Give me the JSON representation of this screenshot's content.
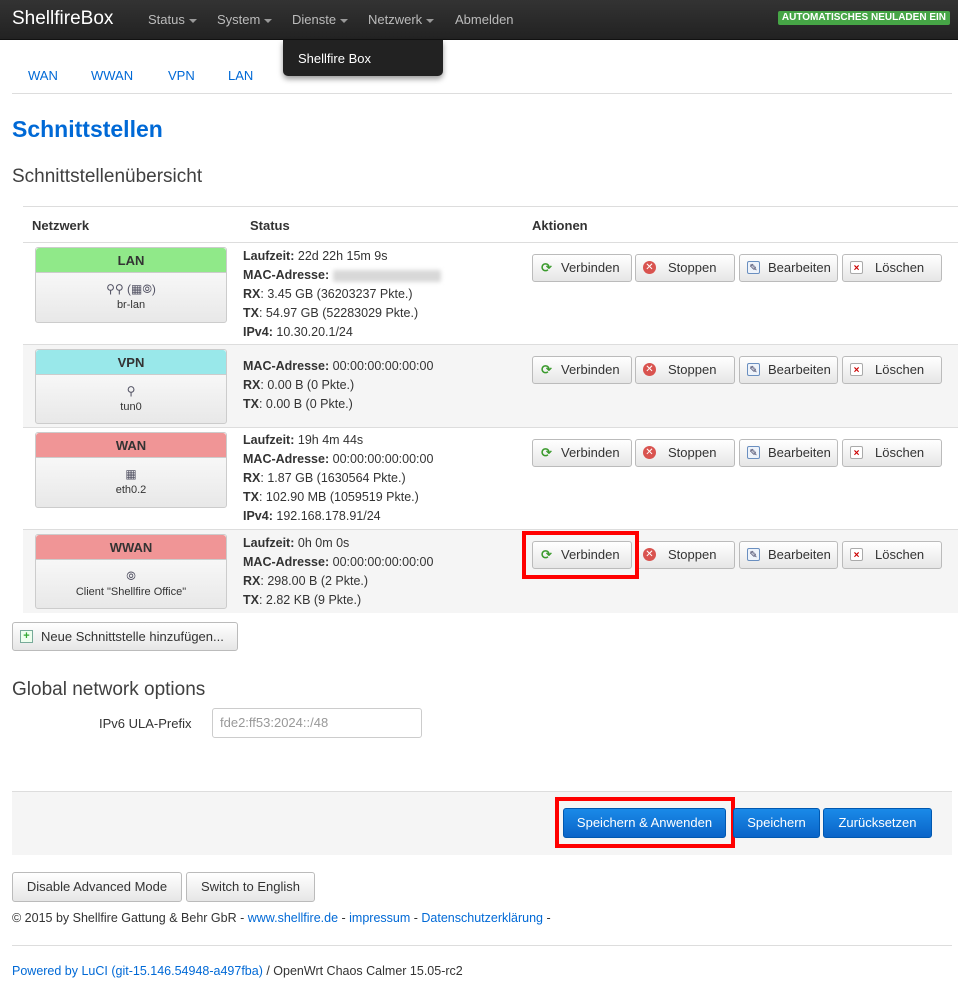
{
  "brand": "ShellfireBox",
  "nav": {
    "items": [
      "Status",
      "System",
      "Dienste",
      "Netzwerk",
      "Abmelden"
    ],
    "auto_reload": "AUTOMATISCHES NEULADEN EIN",
    "dropdown_item": "Shellfire Box"
  },
  "subtabs": [
    "WAN",
    "WWAN",
    "VPN",
    "LAN"
  ],
  "page_title": "Schnittstellen",
  "overview_heading": "Schnittstellenübersicht",
  "table": {
    "headers": [
      "Netzwerk",
      "Status",
      "Aktionen"
    ],
    "actions": {
      "connect": "Verbinden",
      "stop": "Stoppen",
      "edit": "Bearbeiten",
      "delete": "Löschen"
    },
    "rows": [
      {
        "name": "LAN",
        "color": "#90e989",
        "icons": "⚲⚲ (▦⦾)",
        "device": "br-lan",
        "status": [
          {
            "k": "Laufzeit:",
            "v": " 22d 22h 15m 9s"
          },
          {
            "k": "MAC-Adresse:",
            "v": ""
          },
          {
            "k": "RX",
            "v": ": 3.45 GB (36203237 Pkte.)"
          },
          {
            "k": "TX",
            "v": ": 54.97 GB (52283029 Pkte.)"
          },
          {
            "k": "IPv4:",
            "v": " 10.30.20.1/24"
          }
        ]
      },
      {
        "name": "VPN",
        "color": "#99e8ea",
        "icons": "⚲",
        "device": "tun0",
        "status": [
          {
            "k": "MAC-Adresse:",
            "v": " 00:00:00:00:00:00"
          },
          {
            "k": "RX",
            "v": ": 0.00 B (0 Pkte.)"
          },
          {
            "k": "TX",
            "v": ": 0.00 B (0 Pkte.)"
          }
        ]
      },
      {
        "name": "WAN",
        "color": "#f09596",
        "icons": "▦",
        "device": "eth0.2",
        "status": [
          {
            "k": "Laufzeit:",
            "v": " 19h 4m 44s"
          },
          {
            "k": "MAC-Adresse:",
            "v": " 00:00:00:00:00:00"
          },
          {
            "k": "RX",
            "v": ": 1.87 GB (1630564 Pkte.)"
          },
          {
            "k": "TX",
            "v": ": 102.90 MB (1059519 Pkte.)"
          },
          {
            "k": "IPv4:",
            "v": " 192.168.178.91/24"
          }
        ]
      },
      {
        "name": "WWAN",
        "color": "#f09596",
        "icons": "⦾",
        "device": "Client \"Shellfire Office\"",
        "status": [
          {
            "k": "Laufzeit:",
            "v": " 0h 0m 0s"
          },
          {
            "k": "MAC-Adresse:",
            "v": " 00:00:00:00:00:00"
          },
          {
            "k": "RX",
            "v": ": 298.00 B (2 Pkte.)"
          },
          {
            "k": "TX",
            "v": ": 2.82 KB (9 Pkte.)"
          }
        ]
      }
    ]
  },
  "add_interface": "Neue Schnittstelle hinzufügen...",
  "global_heading": "Global network options",
  "ula": {
    "label": "IPv6 ULA-Prefix",
    "value": "fde2:ff53:2024::/48"
  },
  "buttons": {
    "save_apply": "Speichern & Anwenden",
    "save": "Speichern",
    "reset": "Zurücksetzen"
  },
  "mode": {
    "advanced": "Disable Advanced Mode",
    "english": "Switch to English"
  },
  "footer": {
    "copyright": "© 2015 by Shellfire Gattung & Behr GbR - ",
    "site": "www.shellfire.de",
    "sep1": " - ",
    "impressum": "impressum",
    "sep2": " - ",
    "privacy": "Datenschutzerklärung",
    "sep3": " -",
    "powered": "Powered by LuCI (git-15.146.54948-a497fba)",
    "openwrt": " / OpenWrt Chaos Calmer 15.05-rc2"
  },
  "colors": {
    "accent": "#0069d6",
    "highlight": "#ff0000",
    "auto_reload": "#46a546"
  }
}
